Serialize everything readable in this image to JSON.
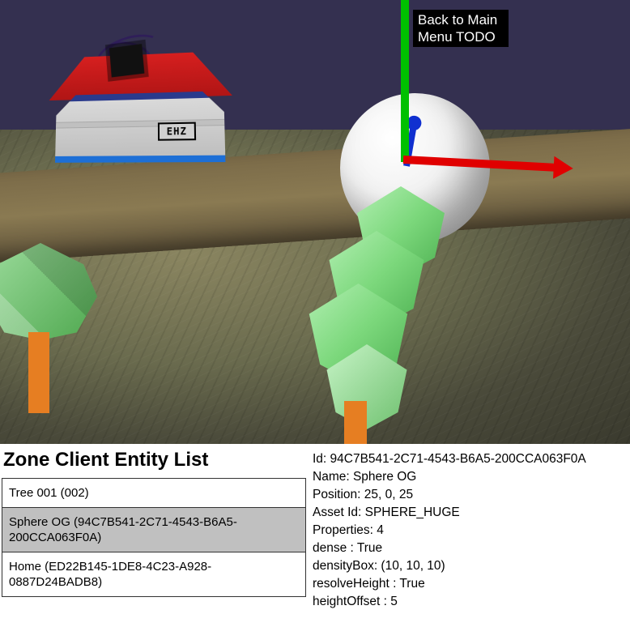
{
  "viewport": {
    "back_button": "Back to Main\nMenu TODO",
    "house_sign": "EHZ"
  },
  "panel": {
    "title": "Zone Client Entity List",
    "entities": [
      {
        "label": "Tree 001 (002)",
        "selected": false
      },
      {
        "label": "Sphere OG (94C7B541-2C71-4543-B6A5-200CCA063F0A)",
        "selected": true
      },
      {
        "label": "Home (ED22B145-1DE8-4C23-A928-0887D24BADB8)",
        "selected": false
      }
    ]
  },
  "details": {
    "id_label": "Id: 94C7B541-2C71-4543-B6A5-200CCA063F0A",
    "name_label": "Name: Sphere OG",
    "position_label": "Position: 25, 0, 25",
    "asset_label": "Asset Id: SPHERE_HUGE",
    "props_count_label": "Properties: 4",
    "prop_dense": "dense : True",
    "prop_densityBox": "densityBox: (10, 10, 10)",
    "prop_resolveHeight": "resolveHeight : True",
    "prop_heightOffset": "heightOffset : 5"
  }
}
